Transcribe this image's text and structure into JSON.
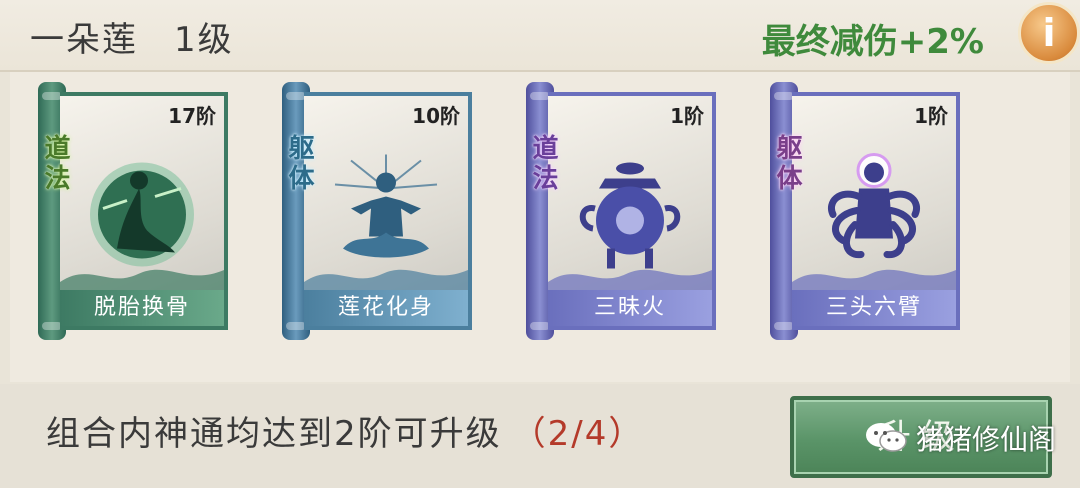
{
  "header": {
    "name": "一朵莲",
    "level": "1级",
    "bonus": "最终减伤+2%",
    "info_icon": "i"
  },
  "cards": [
    {
      "rank": "17阶",
      "tag": "道法",
      "name": "脱胎换骨",
      "icon": "twin-figures-art"
    },
    {
      "rank": "10阶",
      "tag": "躯体",
      "name": "莲花化身",
      "icon": "lotus-meditation-art"
    },
    {
      "rank": "1阶",
      "tag": "道法",
      "name": "三昧火",
      "icon": "incense-burner-art"
    },
    {
      "rank": "1阶",
      "tag": "躯体",
      "name": "三头六臂",
      "icon": "six-armed-figure-art"
    }
  ],
  "footer": {
    "requirement": "组合内神通均达到2阶可升级",
    "progress": "（2/4）",
    "button_label": "升级",
    "watermark": "猪猪修仙阁"
  },
  "colors": {
    "bonus_green": "#3f8a3c",
    "progress_red": "#b43a2a",
    "button_green": "#5a9468"
  }
}
